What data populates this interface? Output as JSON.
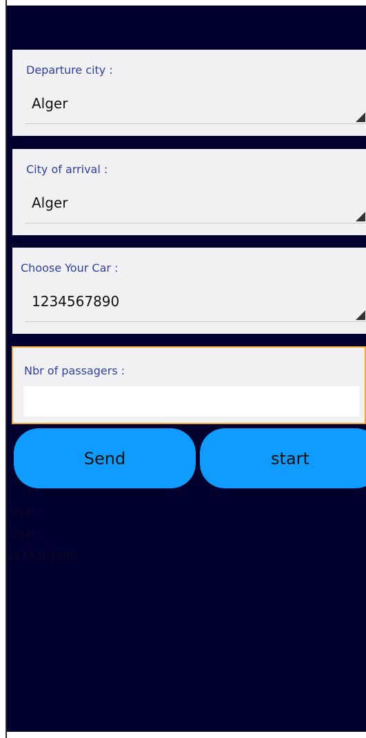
{
  "form": {
    "departure": {
      "label": "Departure city :",
      "value": "Alger"
    },
    "arrival": {
      "label": "City of arrival :",
      "value": "Alger"
    },
    "car": {
      "label": "Choose Your Car :",
      "value": "1234567890"
    },
    "passengers": {
      "label": "Nbr of passagers :",
      "value": ""
    }
  },
  "actions": {
    "send_label": "Send",
    "start_label": "start"
  },
  "results": [
    "Alger",
    "Alger",
    "1234567890"
  ],
  "colors": {
    "background": "#00002e",
    "card": "#f1f1f3",
    "label": "#2f3f9f",
    "button": "#109cff",
    "focus_border": "#f4a335"
  }
}
